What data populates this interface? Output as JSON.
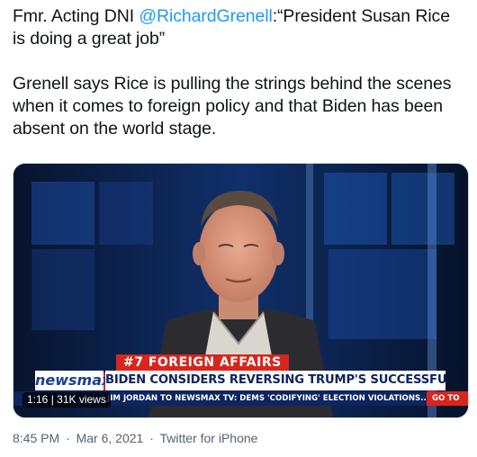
{
  "tweet": {
    "text_prefix": "Fmr. Acting DNI ",
    "mention": "@RichardGrenell",
    "text_suffix": ":“President Susan Rice is doing a great job”",
    "paragraph2": "Grenell says Rice is pulling the strings behind the scenes when it comes to foreign policy and that Biden has been absent on the world stage."
  },
  "video": {
    "category_label": "#7  FOREIGN AFFAIRS",
    "brand": "newsmax",
    "headline": "BIDEN CONSIDERS REVERSING TRUMP'S SUCCESSFUL POLICIES",
    "ticker": "JIM JORDAN TO NEWSMAX TV: DEMS 'CODIFYING' ELECTION VIOLATIONS...",
    "ticker_go": "GO TO",
    "duration": "1:16",
    "views": "31K views"
  },
  "meta": {
    "time": "8:45 PM",
    "date": "Mar 6, 2021",
    "source": "Twitter for iPhone",
    "separator": "·"
  },
  "colors": {
    "mention": "#1d9bf0",
    "newsmax_red": "#d6261d",
    "newsmax_navy": "#0d2560",
    "muted": "#536471"
  }
}
